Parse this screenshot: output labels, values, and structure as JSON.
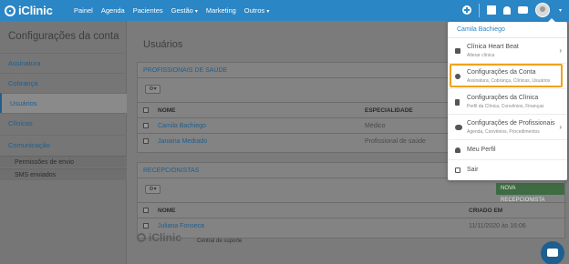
{
  "topbar": {
    "brand": "iClinic",
    "nav": [
      "Painel",
      "Agenda",
      "Pacientes",
      "Gestão",
      "Marketing",
      "Outros"
    ],
    "brand_color": "#2b86c5"
  },
  "sidebar": {
    "title": "Configurações da conta",
    "items": [
      {
        "label": "Assinatura"
      },
      {
        "label": "Cobrança"
      },
      {
        "label": "Usuários"
      },
      {
        "label": "Clínicas"
      },
      {
        "label": "Comunicação"
      }
    ],
    "subitems": [
      {
        "label": "Permissões de envio"
      },
      {
        "label": "SMS enviados"
      }
    ]
  },
  "main": {
    "title": "Usuários",
    "professionals": {
      "heading": "PROFISSIONAIS DE SAÚDE",
      "columns": [
        "NOME",
        "ESPECIALIDADE"
      ],
      "rows": [
        {
          "name": "Camila Bachiego",
          "specialty": "Médico"
        },
        {
          "name": "Janaina Medrado",
          "specialty": "Profissional de saúde"
        }
      ]
    },
    "receptionists": {
      "heading": "RECEPCIONISTAS",
      "new_button": "NOVA RECEPCIONISTA",
      "columns": [
        "NOME",
        "CRIADO EM"
      ],
      "rows": [
        {
          "name": "Juliana Fonseca",
          "created": "11/11/2020 às 16:06"
        }
      ]
    }
  },
  "footer": {
    "brand": "iClinic",
    "link": "Central de suporte"
  },
  "dropdown": {
    "user": "Camila Bachiego",
    "items": [
      {
        "label": "Clínica Heart Beat",
        "sub": "Alterar clínica",
        "icon": "clinic-icon"
      },
      {
        "label": "Configurações da Conta",
        "sub": "Assinatura, Cobrança, Clínicas, Usuários",
        "icon": "gear-icon"
      },
      {
        "label": "Configurações da Clínica",
        "sub": "Perfil da Clínica, Convênios, Finanças",
        "icon": "clipboard-icon"
      },
      {
        "label": "Configurações de Profissionais",
        "sub": "Agenda, Convênios, Procedimentos",
        "icon": "users-icon"
      },
      {
        "label": "Meu Perfil",
        "sub": "",
        "icon": "user-icon"
      },
      {
        "label": "Sair",
        "sub": "",
        "icon": "logout-icon"
      }
    ],
    "highlight_color": "#f0a21a"
  }
}
